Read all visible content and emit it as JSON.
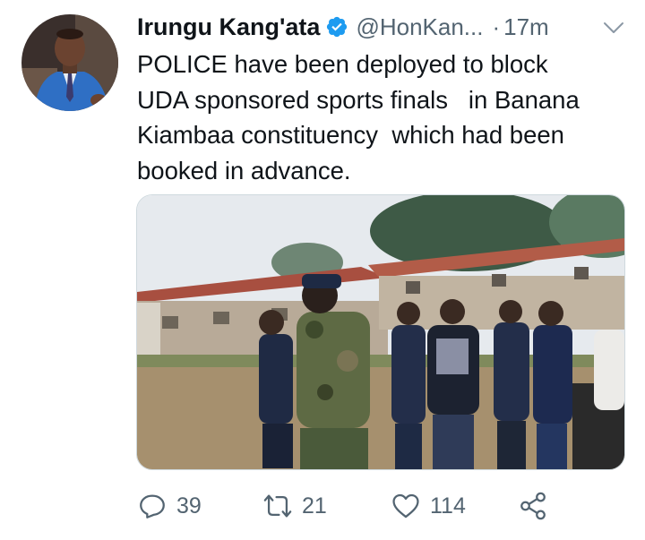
{
  "author": {
    "name": "Irungu Kang'ata",
    "handle": "@HonKan...",
    "time_sep": "·",
    "time": "17m",
    "avatar_icon": "profile-photo"
  },
  "tweet": {
    "text": "POLICE have been deployed to block\nUDA sponsored sports finals   in Banana\nKiambaa constituency  which had been\nbooked in advance."
  },
  "media": {
    "icon": "photo-police-at-sports-field"
  },
  "actions": {
    "reply_count": "39",
    "retweet_count": "21",
    "like_count": "114"
  },
  "colors": {
    "verified_blue": "#1d9bf0",
    "icon_gray": "#536471"
  }
}
